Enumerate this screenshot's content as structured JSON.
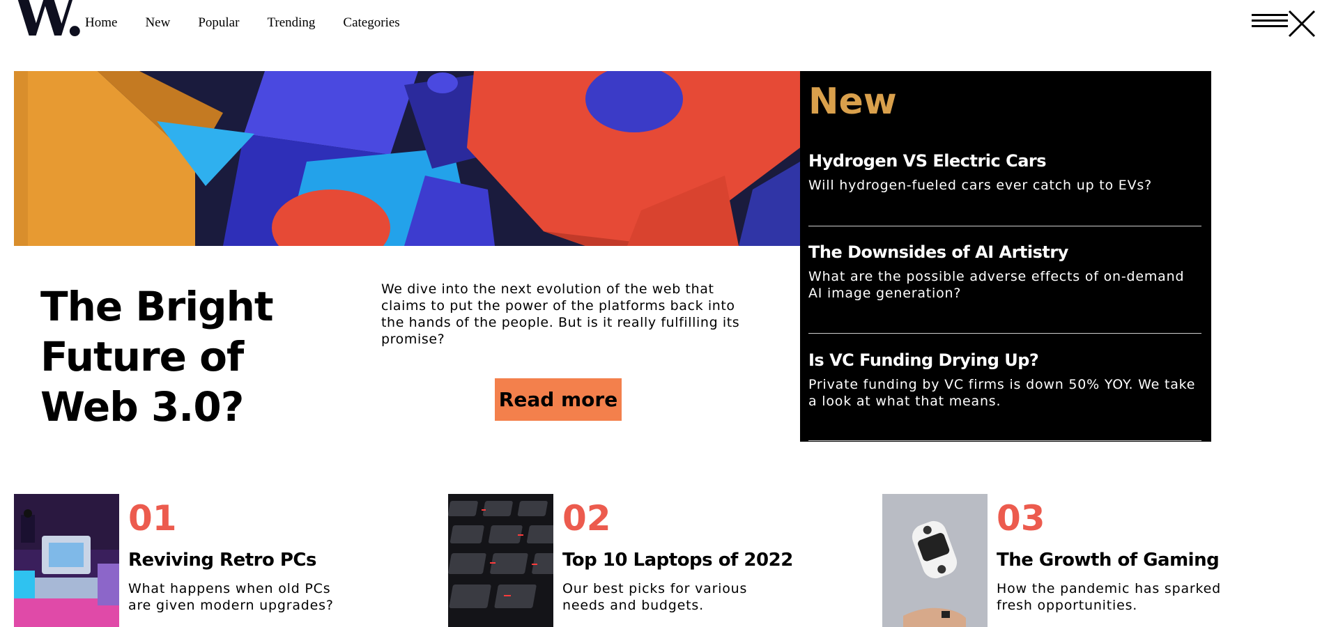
{
  "header": {
    "logo_text": "W.",
    "nav": [
      "Home",
      "New",
      "Popular",
      "Trending",
      "Categories"
    ],
    "menu_icon": "menu-close-icon"
  },
  "hero": {
    "title": "The Bright Future of Web 3.0?",
    "description": "We dive into the next evolution of the web that claims to put the power of the platforms back into the hands of the people. But is it really fulfilling its promise?",
    "cta_label": "Read more",
    "cta_color": "#f3804c"
  },
  "new_section": {
    "title": "New",
    "title_color": "#d9a04c",
    "items": [
      {
        "title": "Hydrogen VS Electric Cars",
        "summary": "Will hydrogen-fueled cars ever catch up to EVs?"
      },
      {
        "title": "The Downsides of AI Artistry",
        "summary": "What are the possible adverse effects of on-demand AI image generation?"
      },
      {
        "title": "Is VC Funding Drying Up?",
        "summary": "Private funding by VC firms is down 50% YOY. We take a look at what that means."
      }
    ]
  },
  "top_articles": [
    {
      "number": "01",
      "title": "Reviving Retro PCs",
      "summary": "What happens when old PCs are given modern upgrades?"
    },
    {
      "number": "02",
      "title": "Top 10 Laptops of 2022",
      "summary": "Our best picks for various needs and budgets."
    },
    {
      "number": "03",
      "title": "The Growth of Gaming",
      "summary": "How the pandemic has sparked fresh opportunities."
    }
  ],
  "accent_color": "#ec5b4e"
}
